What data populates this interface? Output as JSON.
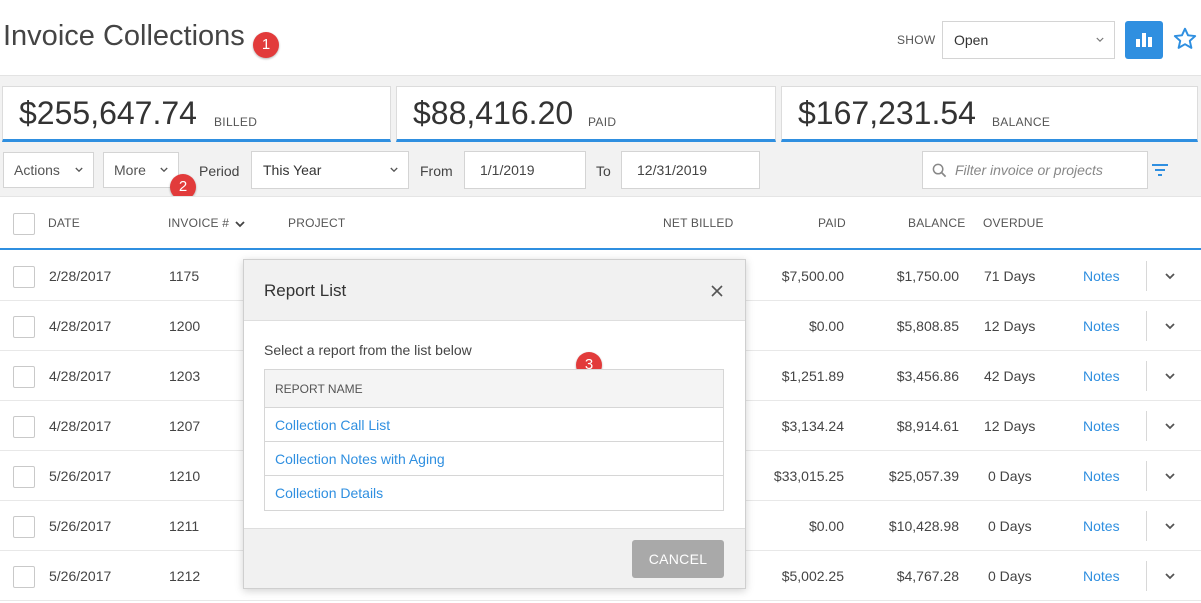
{
  "header": {
    "title": "Invoice Collections",
    "show_label": "SHOW",
    "show_value": "Open",
    "chart_button_icon": "bar-chart-icon",
    "favorite_icon": "star-icon"
  },
  "markers": [
    "1",
    "2",
    "3"
  ],
  "summary": {
    "billed_amount": "$255,647.74",
    "billed_label": "BILLED",
    "paid_amount": "$88,416.20",
    "paid_label": "PAID",
    "balance_amount": "$167,231.54",
    "balance_label": "BALANCE"
  },
  "toolbar": {
    "actions_label": "Actions",
    "more_label": "More",
    "period_label": "Period",
    "period_value": "This Year",
    "from_label": "From",
    "from_value": "1/1/2019",
    "to_label": "To",
    "to_value": "12/31/2019",
    "search_placeholder": "Filter invoice or projects"
  },
  "table": {
    "columns": {
      "date": "DATE",
      "invoice": "INVOICE #",
      "project": "PROJECT",
      "net_billed": "NET BILLED",
      "paid": "PAID",
      "balance": "BALANCE",
      "overdue": "OVERDUE"
    },
    "notes_label": "Notes",
    "rows": [
      {
        "date": "2/28/2017",
        "invoice": "1175",
        "paid": "$7,500.00",
        "balance": "$1,750.00",
        "overdue": "71 Days"
      },
      {
        "date": "4/28/2017",
        "invoice": "1200",
        "paid": "$0.00",
        "balance": "$5,808.85",
        "overdue": "12 Days"
      },
      {
        "date": "4/28/2017",
        "invoice": "1203",
        "paid": "$1,251.89",
        "balance": "$3,456.86",
        "overdue": "42 Days"
      },
      {
        "date": "4/28/2017",
        "invoice": "1207",
        "paid": "$3,134.24",
        "balance": "$8,914.61",
        "overdue": "12 Days"
      },
      {
        "date": "5/26/2017",
        "invoice": "1210",
        "paid": "$33,015.25",
        "balance": "$25,057.39",
        "overdue": "0 Days"
      },
      {
        "date": "5/26/2017",
        "invoice": "1211",
        "paid": "$0.00",
        "balance": "$10,428.98",
        "overdue": "0 Days"
      },
      {
        "date": "5/26/2017",
        "invoice": "1212",
        "paid": "$5,002.25",
        "balance": "$4,767.28",
        "overdue": "0 Days"
      }
    ]
  },
  "modal": {
    "title": "Report List",
    "instructions": "Select a report from the list below",
    "column_header": "REPORT NAME",
    "reports": [
      "Collection Call List",
      "Collection Notes with Aging",
      "Collection Details"
    ],
    "cancel_label": "CANCEL"
  },
  "colors": {
    "accent": "#2f8fe0",
    "marker": "#e23b3b"
  }
}
